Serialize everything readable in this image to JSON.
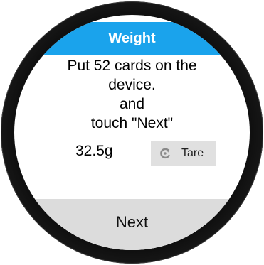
{
  "app": {
    "title": "Weight"
  },
  "instructions": {
    "line1": "Put 52 cards on the",
    "line2": "device.",
    "line3": "and",
    "line4": "touch \"Next\""
  },
  "scale": {
    "reading": "32.5g"
  },
  "tare": {
    "label": "Tare",
    "icon": "refresh-icon"
  },
  "footer": {
    "next_label": "Next"
  },
  "colors": {
    "title_bar": "#1aa3ec",
    "next_bar": "#dcdcdc",
    "tare_button": "#e0e0e0"
  }
}
